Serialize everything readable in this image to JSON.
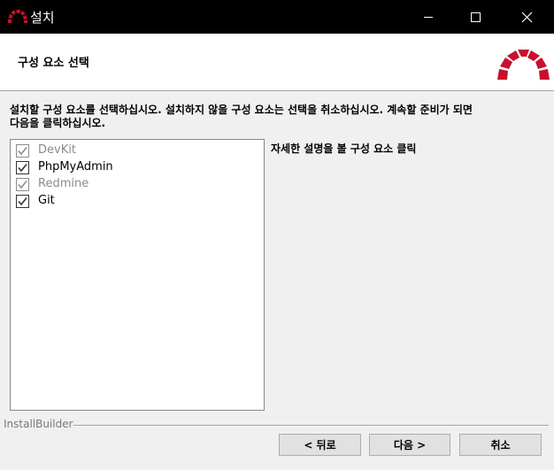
{
  "window": {
    "title": "설치",
    "icons": {
      "app": "redmine-logo-icon",
      "minimize": "minimize-icon",
      "maximize": "maximize-icon",
      "close": "close-icon"
    }
  },
  "header": {
    "title": "구성 요소 선택",
    "logo": "redmine-logo-icon"
  },
  "instruction": {
    "line1": "설치할 구성 요소를 선택하십시오. 설치하지 않을 구성 요소는 선택을 취소하십시오. 계속할 준비가 되면",
    "line2": "다음을 클릭하십시오."
  },
  "components": [
    {
      "label": "DevKit",
      "checked": true,
      "enabled": false
    },
    {
      "label": "PhpMyAdmin",
      "checked": true,
      "enabled": true
    },
    {
      "label": "Redmine",
      "checked": true,
      "enabled": false
    },
    {
      "label": "Git",
      "checked": true,
      "enabled": true
    }
  ],
  "description_hint": "자세한 설명을 볼 구성 요소 클릭",
  "footer": {
    "brand": "InstallBuilder"
  },
  "buttons": {
    "back": "< 뒤로",
    "next": "다음 >",
    "cancel": "취소"
  },
  "colors": {
    "brand_red": "#c8102e",
    "titlebar": "#000000"
  }
}
